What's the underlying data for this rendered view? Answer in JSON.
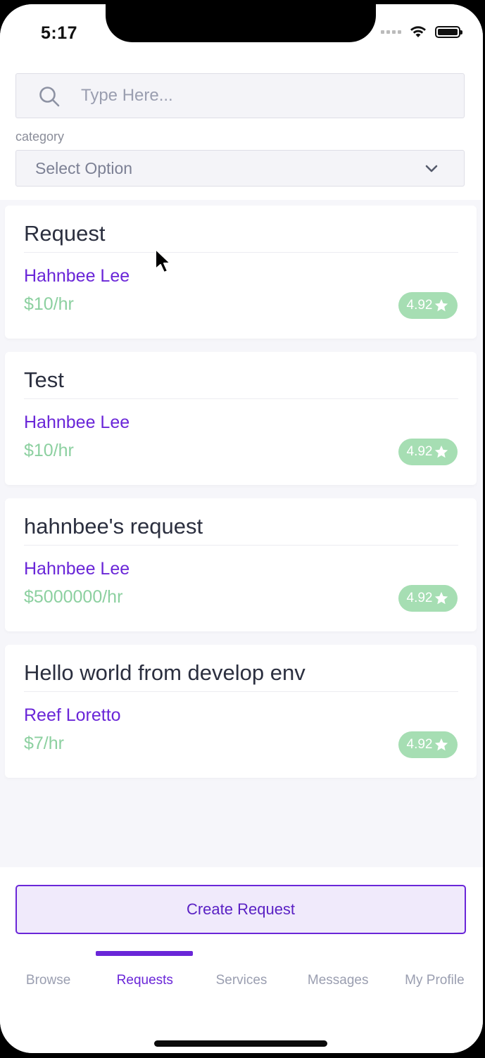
{
  "status_bar": {
    "time": "5:17"
  },
  "search": {
    "placeholder": "Type Here..."
  },
  "category": {
    "label": "category",
    "selected": "Select Option"
  },
  "requests": [
    {
      "title": "Request",
      "user": "Hahnbee Lee",
      "rate": "$10/hr",
      "rating": "4.92"
    },
    {
      "title": "Test",
      "user": "Hahnbee Lee",
      "rate": "$10/hr",
      "rating": "4.92"
    },
    {
      "title": "hahnbee's request",
      "user": "Hahnbee Lee",
      "rate": "$5000000/hr",
      "rating": "4.92"
    },
    {
      "title": "Hello world from develop env",
      "user": "Reef Loretto",
      "rate": "$7/hr",
      "rating": "4.92"
    }
  ],
  "create_button": {
    "label": "Create Request"
  },
  "tabs": [
    {
      "label": "Browse",
      "active": false
    },
    {
      "label": "Requests",
      "active": true
    },
    {
      "label": "Services",
      "active": false
    },
    {
      "label": "Messages",
      "active": false
    },
    {
      "label": "My Profile",
      "active": false
    }
  ],
  "colors": {
    "accent": "#6a26d8",
    "rate_green": "#8cd0a0",
    "badge_green": "#a6deb3"
  }
}
